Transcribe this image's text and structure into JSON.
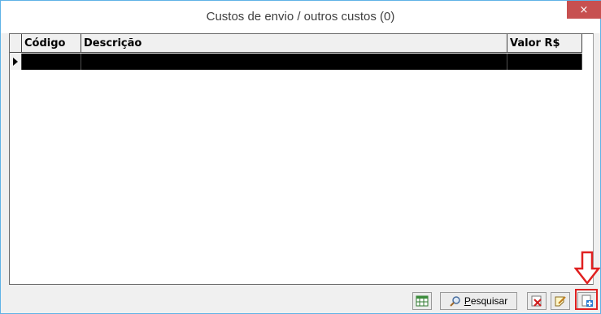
{
  "window": {
    "title": "Custos de envio / outros custos (0)",
    "close_label": "×"
  },
  "grid": {
    "columns": [
      "Código",
      "Descrição",
      "Valor R$"
    ],
    "rows": [
      {
        "codigo": "",
        "descricao": "",
        "valor": ""
      }
    ]
  },
  "toolbar": {
    "excel_icon": "excel-export-icon",
    "search_label_accel": "P",
    "search_label_rest": "esquisar",
    "delete_icon": "delete-record-icon",
    "edit_icon": "edit-record-icon",
    "add_icon": "add-record-icon"
  },
  "annotation": {
    "arrow_color": "#e02020",
    "arrow_icon": "down-arrow-icon"
  },
  "colors": {
    "close_button": "#c75050",
    "window_border": "#5fb2e6",
    "selected_row": "#000000"
  }
}
